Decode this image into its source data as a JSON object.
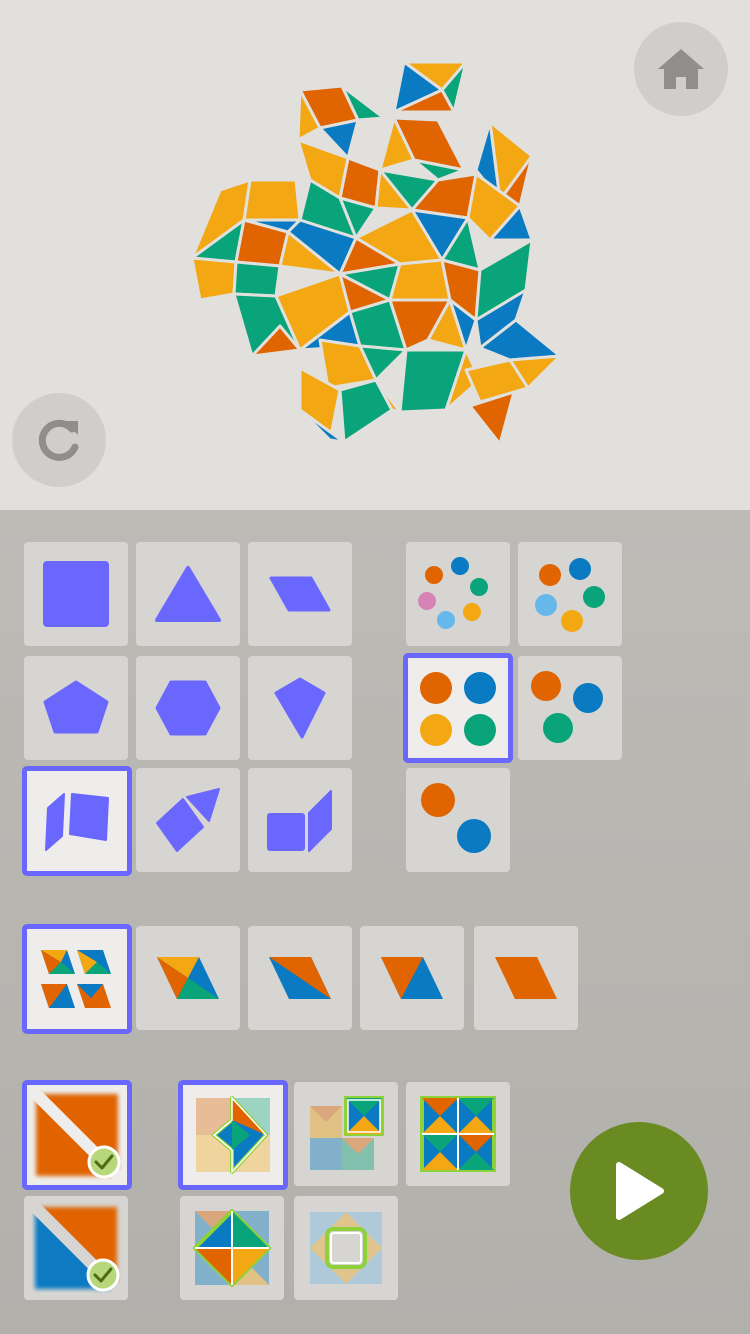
{
  "app": {
    "colors": {
      "accent": "#6a67ff",
      "orange": "#e06400",
      "yellow": "#f3a712",
      "blue": "#0a7ac2",
      "green": "#0aa47a",
      "pink": "#d883b8",
      "light_blue": "#66b8ea",
      "play_green": "#6a8a22"
    }
  },
  "toolbar": {
    "home_icon": "home-icon",
    "redo_icon": "redo-icon",
    "play_icon": "play-icon"
  },
  "palette": {
    "shapes": [
      "square",
      "triangle",
      "parallelogram",
      "pentagon",
      "hexagon",
      "kite",
      "split-rhombus",
      "rhombus-triangle",
      "square-parallelogram"
    ],
    "selected_shape": "split-rhombus",
    "color_sets": [
      "six-colors",
      "five-colors",
      "four-colors",
      "three-colors",
      "two-colors"
    ],
    "selected_color_set": "four-colors",
    "fill_styles": [
      "mixed",
      "four-triangle",
      "two-triangle-blue-orange",
      "two-triangle-orange-blue",
      "solid-orange"
    ],
    "selected_fill_style": "mixed",
    "backgrounds": [
      "orange-with-stripe",
      "blue-with-stripe"
    ],
    "selected_background": "orange-with-stripe",
    "symmetries": [
      "diamond-arrow",
      "corner-square",
      "full-grid",
      "diamond-center",
      "empty-square"
    ],
    "selected_symmetry": "diamond-arrow"
  }
}
